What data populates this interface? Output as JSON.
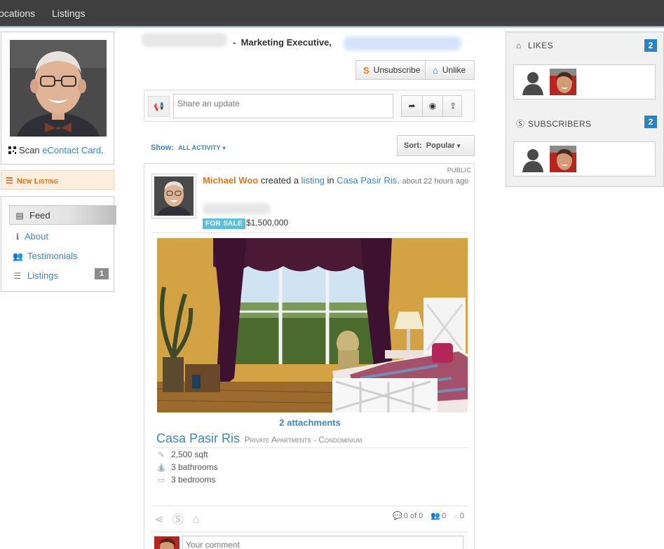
{
  "nav": {
    "items": [
      "ocations",
      "Listings"
    ]
  },
  "profile": {
    "scan_prefix": "Scan ",
    "scan_link": "eContact Card",
    "scan_suffix": ".",
    "new_listing": "New Listing"
  },
  "sidebar": {
    "items": [
      {
        "label": "Feed",
        "icon": "feed-icon"
      },
      {
        "label": "About",
        "icon": "info-icon"
      },
      {
        "label": "Testimonials",
        "icon": "users-icon"
      },
      {
        "label": "Listings",
        "icon": "list-icon",
        "badge": "1"
      }
    ]
  },
  "header": {
    "separator": "-",
    "role": "Marketing Executive,",
    "unsubscribe": "Unsubscribe",
    "unlike": "Unlike"
  },
  "share": {
    "placeholder": "Share an update"
  },
  "filter": {
    "show_label": "Show:",
    "show_value": "ALL ACTIVITY",
    "sort_label": "Sort:",
    "sort_value": "Popular"
  },
  "activity": {
    "visibility": "PUBLIC",
    "author": "Michael Woo",
    "verb": "created a",
    "object": "listing",
    "prep": "in",
    "place": "Casa Pasir Ris.",
    "ago": "about 22 hours ago",
    "status": "FOR SALE",
    "price": "$1,500,000",
    "attachments": "2 attachments",
    "listing_name": "Casa Pasir Ris",
    "listing_sub": "Private Apartments - Condominium",
    "specs": [
      "2,500 sqft",
      "3 bathrooms",
      "3 bedrooms"
    ],
    "comments_count": "0 of 0",
    "likes_count": "0",
    "subs_count": "0",
    "comment_placeholder": "Your comment"
  },
  "right": {
    "likes_label": "LIKES",
    "likes_count": "2",
    "subscribers_label": "SUBSCRIBERS",
    "subscribers_count": "2"
  },
  "colors": {
    "nav_bg": "#3f3f3f",
    "link": "#3a87c9",
    "author": "#e07a1a",
    "badge_blue": "#2b82c7",
    "for_sale": "#5bc0de"
  }
}
